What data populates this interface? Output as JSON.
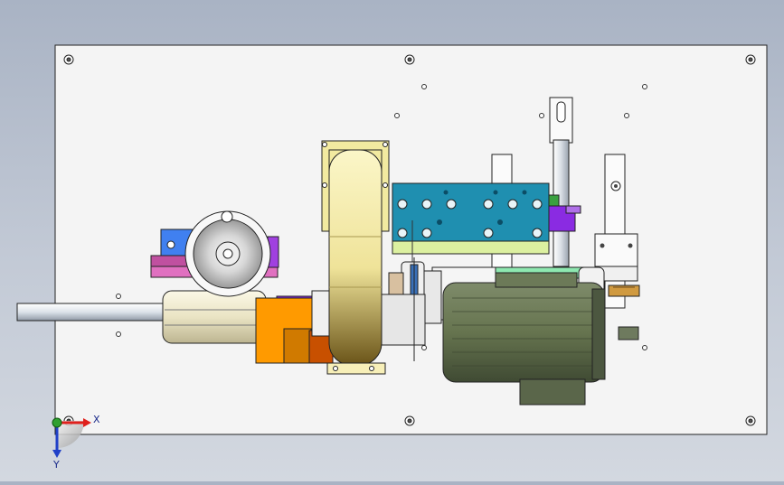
{
  "viewport": {
    "background_top": "#a9b3c4",
    "background_bottom": "#d3d8e0"
  },
  "triad": {
    "x_label": "X",
    "y_label": "Y",
    "x_color": "#e0201c",
    "y_color": "#2040c8",
    "z_color": "#30a030"
  },
  "colors": {
    "plate": "#f4f4f4",
    "teal_block": "#1f8fb0",
    "yellow_wheel": "#f2eaa0",
    "motor_olive": "#5d6a4e",
    "purple": "#8a2be2",
    "orange": "#ff9a00",
    "pink": "#c050a0",
    "blue_block": "#4080f0",
    "mint": "#8ee8b0",
    "light_green": "#d8f0a0"
  }
}
